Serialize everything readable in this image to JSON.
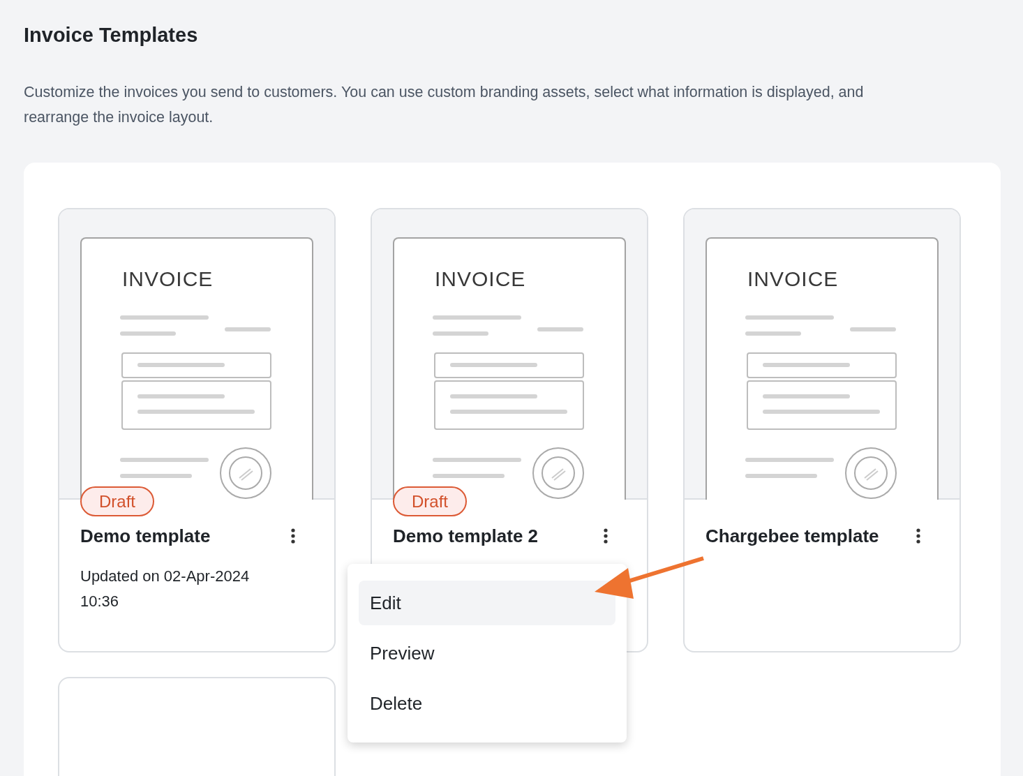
{
  "page": {
    "title": "Invoice Templates",
    "description": "Customize the invoices you send to customers. You can use custom branding assets, select what information is displayed, and rearrange the invoice layout."
  },
  "templates": [
    {
      "kind": "template",
      "preview_heading": "INVOICE",
      "badge": "Draft",
      "title": "Demo template",
      "updated": "Updated on 02-Apr-2024 10:36",
      "menu_open": false
    },
    {
      "kind": "template",
      "preview_heading": "INVOICE",
      "badge": "Draft",
      "title": "Demo template 2",
      "menu_open": true
    },
    {
      "kind": "template",
      "preview_heading": "INVOICE",
      "title": "Chargebee template",
      "menu_open": false
    },
    {
      "kind": "blank"
    }
  ],
  "menu": {
    "items": [
      {
        "label": "Edit",
        "selected": true
      },
      {
        "label": "Preview",
        "selected": false
      },
      {
        "label": "Delete",
        "selected": false
      }
    ]
  }
}
